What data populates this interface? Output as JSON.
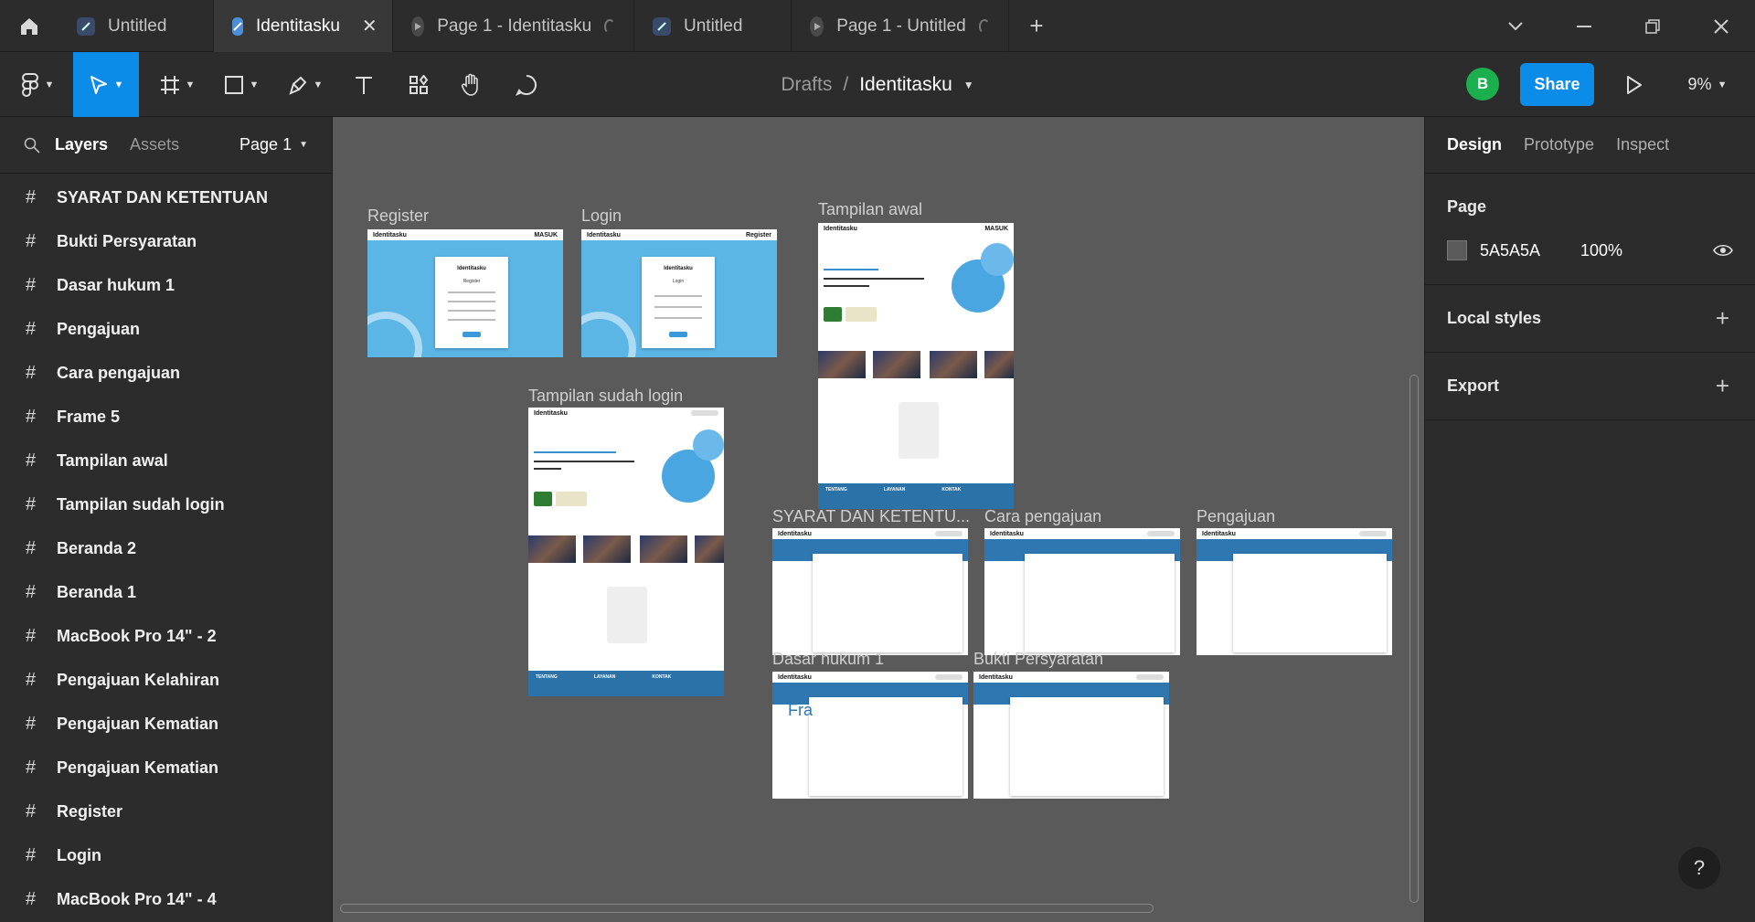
{
  "tabs": [
    {
      "label": "Untitled",
      "kind": "file",
      "active": false
    },
    {
      "label": "Identitasku",
      "kind": "file",
      "active": true
    },
    {
      "label": "Page 1 - Identitasku",
      "kind": "prototype",
      "active": false
    },
    {
      "label": "Untitled",
      "kind": "file",
      "active": false
    },
    {
      "label": "Page 1 - Untitled",
      "kind": "prototype",
      "active": false
    }
  ],
  "toolbar": {
    "breadcrumb_parent": "Drafts",
    "breadcrumb_sep": "/",
    "file_name": "Identitasku",
    "avatar_letter": "B",
    "share_label": "Share",
    "zoom": "9%"
  },
  "left_panel": {
    "tab_layers": "Layers",
    "tab_assets": "Assets",
    "page_select": "Page 1",
    "layers": [
      "SYARAT DAN KETENTUAN",
      "Bukti Persyaratan",
      "Dasar hukum 1",
      "Pengajuan",
      "Cara pengajuan",
      "Frame 5",
      "Tampilan awal",
      "Tampilan sudah login",
      "Beranda 2",
      "Beranda 1",
      "MacBook Pro 14\" - 2",
      "Pengajuan Kelahiran",
      "Pengajuan Kematian",
      "Pengajuan Kematian",
      "Register",
      "Login",
      "MacBook Pro 14\" - 4"
    ]
  },
  "right_panel": {
    "tabs": [
      "Design",
      "Prototype",
      "Inspect"
    ],
    "page_title": "Page",
    "page_color": "5A5A5A",
    "page_opacity": "100%",
    "local_styles": "Local styles",
    "export": "Export",
    "help": "?"
  },
  "canvas": {
    "bg_color": "#5a5a5a",
    "frames": {
      "register": {
        "label": "Register",
        "brand": "Identitasku",
        "nav": "MASUK",
        "card_title": "Identitasku",
        "card_sub": "Register"
      },
      "login": {
        "label": "Login",
        "brand": "Identitasku",
        "nav": "Register",
        "card_title": "Identitasku",
        "card_sub": "Login"
      },
      "tampilan_awal": {
        "label": "Tampilan awal",
        "brand": "Identitasku",
        "nav": "MASUK",
        "footer": [
          "TENTANG",
          "LAYANAN",
          "KONTAK"
        ]
      },
      "sudah_login": {
        "label": "Tampilan sudah login",
        "brand": "Identitasku",
        "footer": [
          "TENTANG",
          "LAYANAN",
          "KONTAK"
        ]
      },
      "syarat": {
        "label": "SYARAT DAN KETENTU...",
        "brand": "Identitasku"
      },
      "cara": {
        "label": "Cara pengajuan",
        "brand": "Identitasku"
      },
      "pengajuan": {
        "label": "Pengajuan",
        "brand": "Identitasku"
      },
      "dasar": {
        "label": "Dasar hukum 1",
        "brand": "Identitasku"
      },
      "bukti": {
        "label": "Bukti Persyaratan",
        "brand": "Identitasku"
      },
      "frame5": {
        "label": "Fra"
      }
    }
  }
}
